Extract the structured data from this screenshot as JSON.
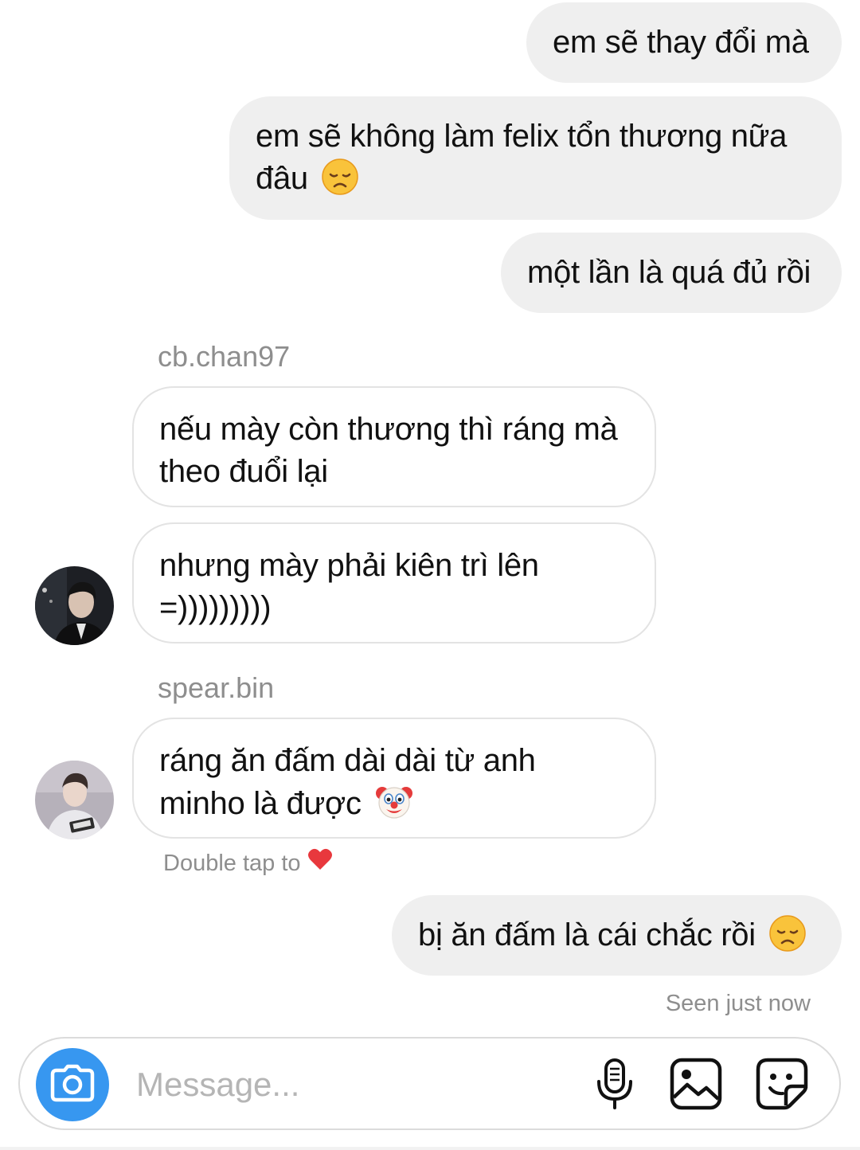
{
  "messages": [
    {
      "text": "em sẽ thay đổi mà"
    },
    {
      "text": "em sẽ không làm felix tổn thương nữa",
      "text2": "đâu",
      "emoji": "disappointed-face"
    },
    {
      "text": "một lần là quá đủ rồi"
    },
    {
      "sender": "cb.chan97",
      "text": "nếu mày còn thương thì ráng mà",
      "text2": "theo đuổi lại"
    },
    {
      "text": "nhưng mày phải kiên trì lên",
      "text2": "=)))))))))"
    },
    {
      "sender": "spear.bin",
      "text": "ráng ăn đấm dài dài từ anh",
      "text2": "minho là được",
      "emoji": "clown-face"
    },
    {
      "text": "bị ăn đấm là cái chắc rồi",
      "emoji": "disappointed-face"
    }
  ],
  "hint": {
    "text": "Double tap to",
    "emoji": "red-heart"
  },
  "seen": "Seen just now",
  "composer": {
    "placeholder": "Message...",
    "icons": [
      "camera-icon",
      "microphone-icon",
      "gallery-icon",
      "sticker-icon"
    ],
    "accent": "#3797f0"
  },
  "colors": {
    "outgoing_bubble": "#efefef",
    "incoming_border": "#e3e3e3",
    "secondary_text": "#8e8e8e"
  }
}
